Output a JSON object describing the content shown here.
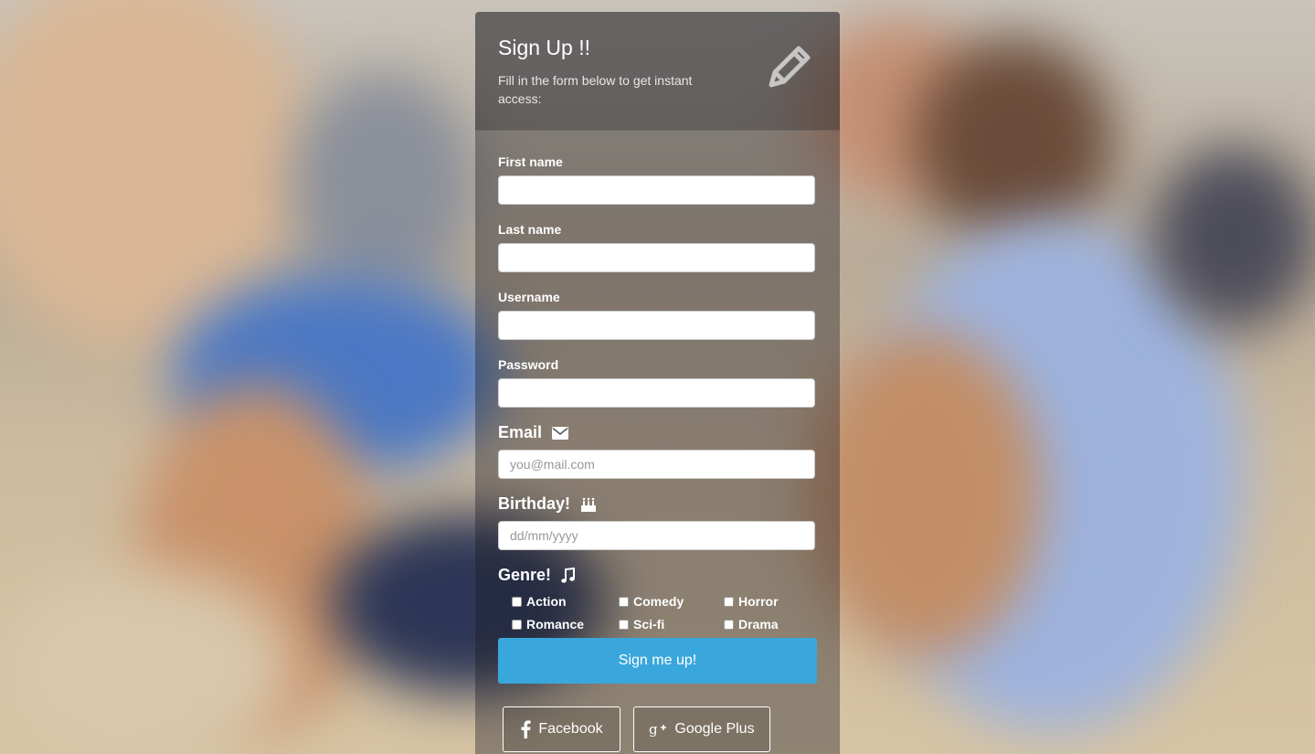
{
  "form": {
    "title": "Sign Up !!",
    "subtitle": "Fill in the form below to get instant access:",
    "fields": {
      "first_name_label": "First name",
      "last_name_label": "Last name",
      "username_label": "Username",
      "password_label": "Password",
      "email_label": "Email",
      "email_placeholder": "you@mail.com",
      "birthday_label": "Birthday!",
      "birthday_placeholder": "dd/mm/yyyy",
      "genre_label": "Genre!"
    },
    "genres": [
      "Action",
      "Comedy",
      "Horror",
      "Romance",
      "Sci-fi",
      "Drama"
    ],
    "submit_label": "Sign me up!",
    "facebook_label": "Facebook",
    "google_label": "Google Plus"
  },
  "icons": {
    "header": "pencil-icon",
    "email": "envelope-icon",
    "birthday": "birthday-cake-icon",
    "genre": "music-note-icon",
    "facebook": "facebook-icon",
    "google": "google-plus-icon"
  },
  "colors": {
    "accent": "#3aa7dc",
    "text": "#ffffff"
  }
}
